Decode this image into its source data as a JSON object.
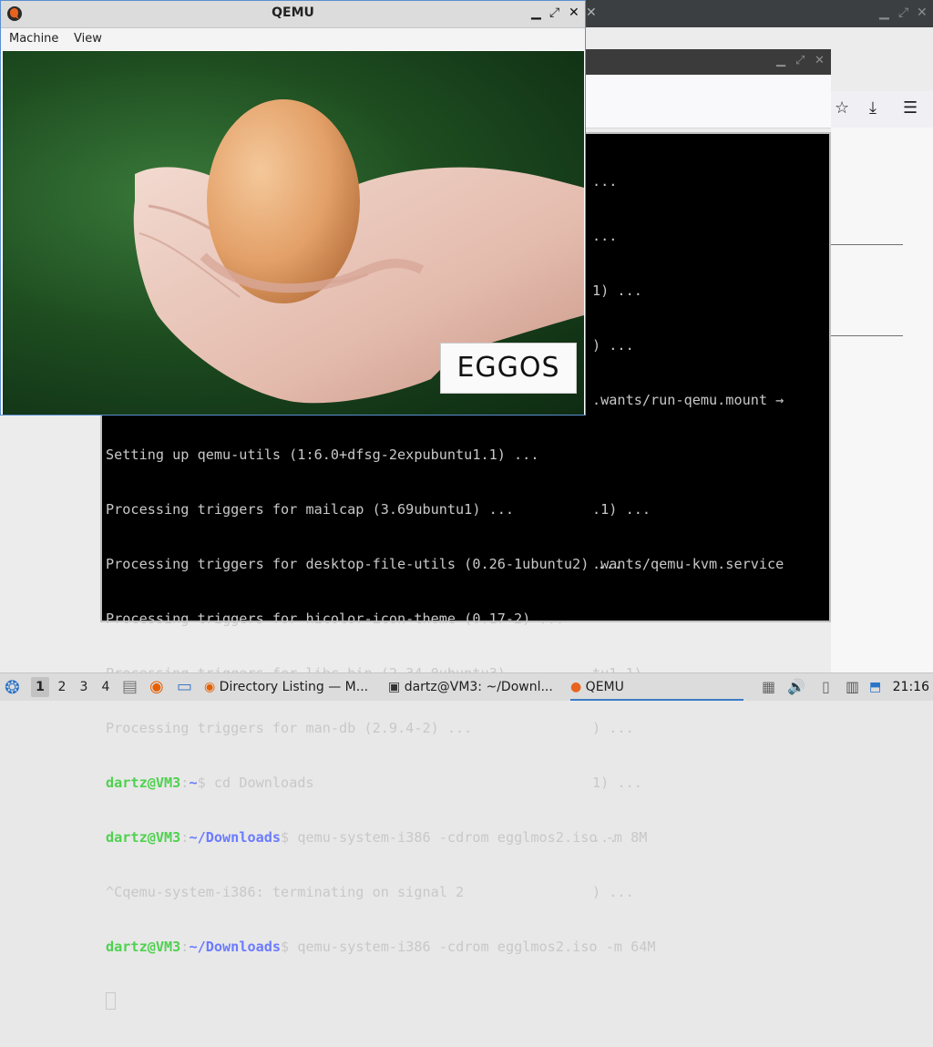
{
  "qemu": {
    "title": "QEMU",
    "menu": [
      "Machine",
      "View"
    ],
    "screen_label": "EGGOS"
  },
  "terminal": {
    "partial_lines": [
      "...",
      "...",
      "1) ...",
      ") ...",
      ".wants/run-qemu.mount →",
      "",
      ".1) ...",
      ".wants/qemu-kvm.service",
      "",
      "tu1.1) ...",
      ") ...",
      "1) ...",
      "...",
      ") ..."
    ],
    "lines": [
      {
        "type": "plain",
        "text": "Setting up qemu-utils (1:6.0+dfsg-2expubuntu1.1) ..."
      },
      {
        "type": "plain",
        "text": "Processing triggers for mailcap (3.69ubuntu1) ..."
      },
      {
        "type": "plain",
        "text": "Processing triggers for desktop-file-utils (0.26-1ubuntu2) ..."
      },
      {
        "type": "plain",
        "text": "Processing triggers for hicolor-icon-theme (0.17-2) ..."
      },
      {
        "type": "plain",
        "text": "Processing triggers for libc-bin (2.34-0ubuntu3) ..."
      },
      {
        "type": "plain",
        "text": "Processing triggers for man-db (2.9.4-2) ..."
      }
    ],
    "prompt_user": "dartz@VM3",
    "prompt1": {
      "path": "~",
      "cmd": " cd Downloads"
    },
    "prompt2": {
      "path": "~/Downloads",
      "cmd": " qemu-system-i386 -cdrom egglmos2.iso -m 8M"
    },
    "signal_line": "^Cqemu-system-i386: terminating on signal 2",
    "prompt3": {
      "path": "~/Downloads",
      "cmd": " qemu-system-i386 -cdrom egglmos2.iso -m 64M"
    }
  },
  "taskbar": {
    "workspaces": [
      "1",
      "2",
      "3",
      "4"
    ],
    "active_workspace": "1",
    "tasks": [
      {
        "label": "Directory Listing — M...",
        "icon": "firefox-icon"
      },
      {
        "label": "dartz@VM3: ~/Downl...",
        "icon": "terminal-icon"
      },
      {
        "label": "QEMU",
        "icon": "qemu-icon"
      }
    ],
    "clock": "21:16"
  },
  "colors": {
    "prompt_user": "#4fd14f",
    "prompt_path": "#6b7bff",
    "active_task": "#3c7ac6"
  }
}
